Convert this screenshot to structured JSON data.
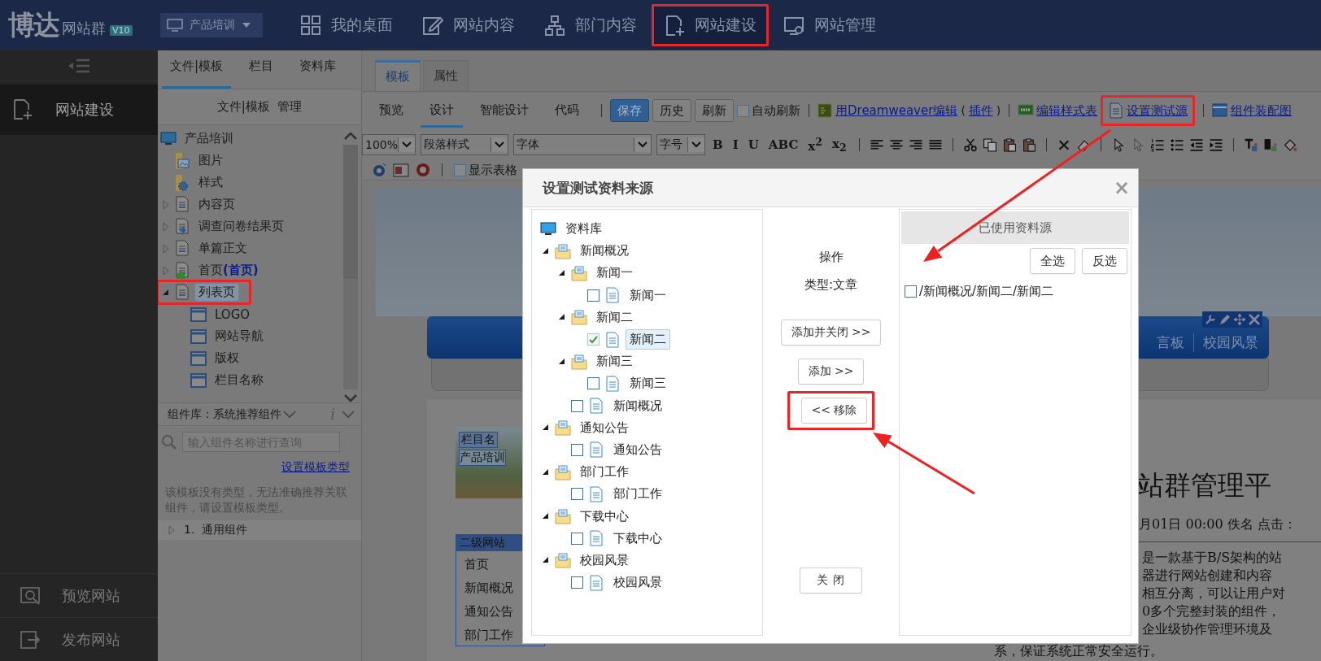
{
  "top_bar": {
    "logo": "博达",
    "logo_suffix": "网站群",
    "version": "V10",
    "site_selector": "产品培训",
    "nav": [
      {
        "label": "我的桌面",
        "selected": false,
        "highlighted": false
      },
      {
        "label": "网站内容",
        "selected": false,
        "highlighted": false
      },
      {
        "label": "部门内容",
        "selected": false,
        "highlighted": false
      },
      {
        "label": "网站建设",
        "selected": true,
        "highlighted": true
      },
      {
        "label": "网站管理",
        "selected": false,
        "highlighted": false
      }
    ]
  },
  "sidebar": {
    "items": [
      {
        "label": "网站建设",
        "selected": true
      }
    ],
    "footer_items": [
      {
        "label": "预览网站"
      },
      {
        "label": "发布网站"
      }
    ]
  },
  "file_panel": {
    "tabs": [
      {
        "label": "文件|模板",
        "selected": true
      },
      {
        "label": "栏目",
        "selected": false
      },
      {
        "label": "资料库",
        "selected": false
      }
    ],
    "heading": "文件|模板  管理",
    "tree": [
      {
        "kind": "site",
        "label": "产品培训",
        "selected": false,
        "children": [
          {
            "kind": "image-folder",
            "label": "图片",
            "selected": false
          },
          {
            "kind": "style-folder",
            "label": "样式",
            "selected": false
          },
          {
            "kind": "page",
            "label": "内容页",
            "expanded": false,
            "selected": false
          },
          {
            "kind": "survey-page",
            "label": "调查问卷结果页",
            "expanded": false,
            "selected": false
          },
          {
            "kind": "page",
            "label": "单篇正文",
            "expanded": false,
            "selected": false
          },
          {
            "kind": "home-page",
            "label": "首页",
            "tag": "(首页)",
            "expanded": false,
            "selected": false
          },
          {
            "kind": "page",
            "label": "列表页",
            "expanded": true,
            "selected": true,
            "highlighted": true,
            "children": [
              {
                "kind": "component",
                "label": "LOGO",
                "selected": false
              },
              {
                "kind": "component",
                "label": "网站导航",
                "selected": false
              },
              {
                "kind": "component",
                "label": "版权",
                "selected": false
              },
              {
                "kind": "component",
                "label": "栏目名称",
                "selected": false
              }
            ]
          }
        ]
      }
    ],
    "component_library": {
      "title": "组件库：系统推荐组件",
      "info": "i",
      "search_placeholder": "输入组件名称进行查询",
      "link": "设置模板类型",
      "notice": "该模板没有类型，无法准确推荐关联组件，请设置模板类型。",
      "groups": [
        {
          "label": "1.  通用组件",
          "expanded": false
        }
      ]
    }
  },
  "editor": {
    "tabs": [
      {
        "label": "模板",
        "selected": true
      },
      {
        "label": "属性",
        "selected": false
      }
    ],
    "view_modes": [
      {
        "label": "预览",
        "selected": false
      },
      {
        "label": "设计",
        "selected": true
      },
      {
        "label": "智能设计",
        "selected": false
      },
      {
        "label": "代码",
        "selected": false
      }
    ],
    "buttons": [
      {
        "label": "保存",
        "primary": true
      },
      {
        "label": "历史",
        "primary": false
      },
      {
        "label": "刷新",
        "primary": false
      }
    ],
    "auto_refresh": {
      "label": "自动刷新",
      "checked": false
    },
    "dreamweaver": {
      "link": "用Dreamweaver编辑",
      "open_paren": "(",
      "plugin_link": "插件",
      "close_paren": ")"
    },
    "links": [
      {
        "label": "编辑样式表",
        "highlighted": false
      },
      {
        "label": "设置测试源",
        "highlighted": true
      },
      {
        "label": "组件装配图",
        "highlighted": false
      }
    ],
    "format_bar": {
      "zoom": "100%",
      "paragraph_style": "段落样式",
      "font": "字体",
      "font_size": "字号",
      "text_buttons": [
        "B",
        "I",
        "U",
        "ABC",
        "x$^{2}$",
        "x$_{2}$"
      ],
      "show_table": {
        "label": "显示表格",
        "checked": false
      }
    },
    "canvas": {
      "nav": [
        "言板",
        "校园风景"
      ],
      "column_box_title": "栏目名",
      "column_box_text": "产品培训",
      "submenu_title": "二级网站",
      "submenu_items": [
        "首页",
        "新闻概况",
        "通知公告",
        "部门工作"
      ],
      "heading": "站群管理平",
      "meta": "月01日 00:00 佚名 点击：",
      "paragraph_lines": [
        "是一款基于B/S架构的站",
        "器进行网站创建和内容",
        "相互分离，可以让用户对",
        "0多个完整封装的组件，",
        "企业级协作管理环境及",
        "系，保证系统正常安全运行。"
      ]
    }
  },
  "dialog": {
    "title": "设置测试资料来源",
    "close": "×",
    "library": {
      "label": "资料库",
      "children": [
        {
          "kind": "folder",
          "label": "新闻概况",
          "expanded": true,
          "children": [
            {
              "kind": "folder",
              "label": "新闻一",
              "expanded": true,
              "children": [
                {
                  "kind": "doc",
                  "label": "新闻一",
                  "checked": false,
                  "selected": false
                }
              ]
            },
            {
              "kind": "folder",
              "label": "新闻二",
              "expanded": true,
              "children": [
                {
                  "kind": "doc",
                  "label": "新闻二",
                  "checked": true,
                  "selected": true
                }
              ]
            },
            {
              "kind": "folder",
              "label": "新闻三",
              "expanded": true,
              "children": [
                {
                  "kind": "doc",
                  "label": "新闻三",
                  "checked": false,
                  "selected": false
                }
              ]
            },
            {
              "kind": "doc",
              "label": "新闻概况",
              "checked": false,
              "selected": false
            }
          ]
        },
        {
          "kind": "folder",
          "label": "通知公告",
          "expanded": true,
          "children": [
            {
              "kind": "doc",
              "label": "通知公告",
              "checked": false,
              "selected": false
            }
          ]
        },
        {
          "kind": "folder",
          "label": "部门工作",
          "expanded": true,
          "children": [
            {
              "kind": "doc",
              "label": "部门工作",
              "checked": false,
              "selected": false
            }
          ]
        },
        {
          "kind": "folder",
          "label": "下载中心",
          "expanded": true,
          "children": [
            {
              "kind": "doc",
              "label": "下载中心",
              "checked": false,
              "selected": false
            }
          ]
        },
        {
          "kind": "folder",
          "label": "校园风景",
          "expanded": true,
          "children": [
            {
              "kind": "doc",
              "label": "校园风景",
              "checked": false,
              "selected": false
            }
          ]
        }
      ]
    },
    "operation_label": "操作",
    "type_label": "类型:文章",
    "actions": [
      {
        "kind": "action",
        "label": "添加并关闭 >>",
        "highlighted": false
      },
      {
        "kind": "action",
        "label": "添加 >>",
        "highlighted": false
      },
      {
        "kind": "action",
        "label": "<< 移除",
        "highlighted": true
      },
      {
        "kind": "close",
        "label": "关 闭",
        "highlighted": false
      }
    ],
    "used_sources": {
      "title": "已使用资料源",
      "buttons": [
        "全选",
        "反选"
      ],
      "items": [
        {
          "label": "/新闻概况/新闻二/新闻二",
          "checked": false
        }
      ]
    }
  }
}
